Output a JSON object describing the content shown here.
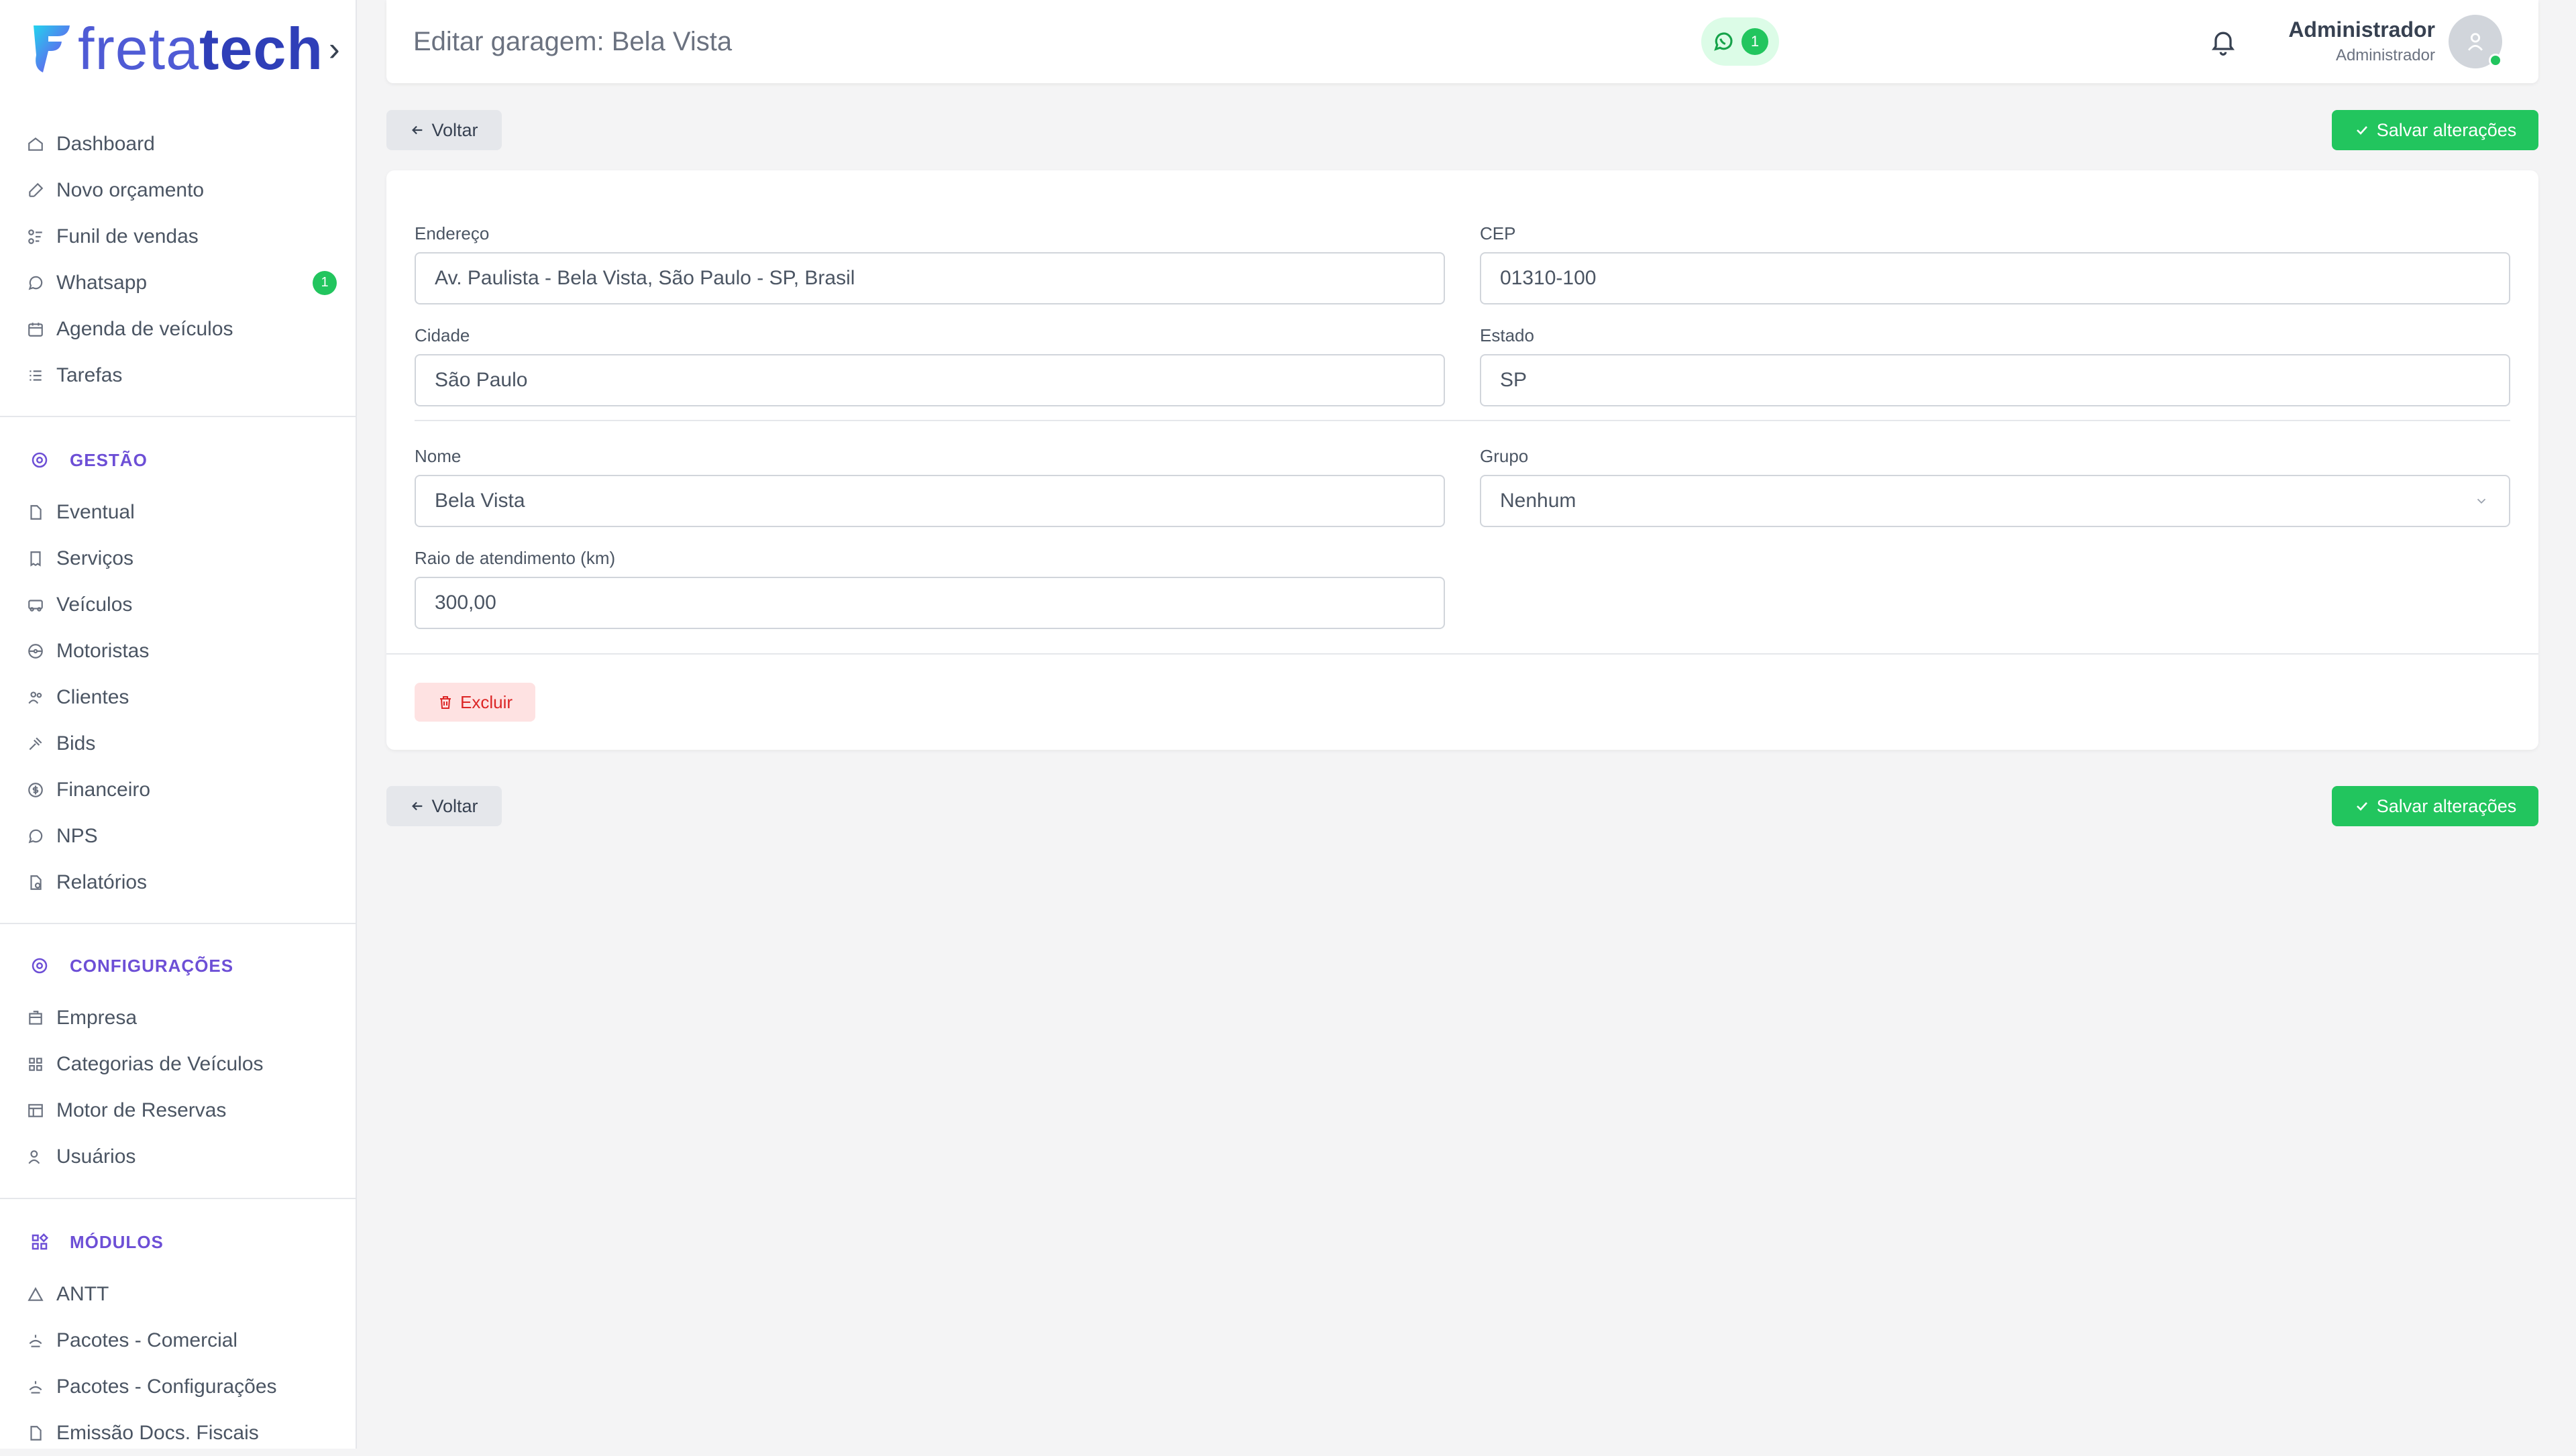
{
  "app": {
    "logo_light": "freta",
    "logo_bold": "tech"
  },
  "sidebar": {
    "main": [
      {
        "label": "Dashboard",
        "icon": "home-icon"
      },
      {
        "label": "Novo orçamento",
        "icon": "edit-icon"
      },
      {
        "label": "Funil de vendas",
        "icon": "funnel-icon"
      },
      {
        "label": "Whatsapp",
        "icon": "whatsapp-icon",
        "badge": "1"
      },
      {
        "label": "Agenda de veículos",
        "icon": "calendar-icon"
      },
      {
        "label": "Tarefas",
        "icon": "list-icon"
      }
    ],
    "sections": [
      {
        "title": "GESTÃO",
        "icon": "gear-icon",
        "items": [
          {
            "label": "Eventual",
            "icon": "document-icon"
          },
          {
            "label": "Serviços",
            "icon": "receipt-icon"
          },
          {
            "label": "Veículos",
            "icon": "bus-icon"
          },
          {
            "label": "Motoristas",
            "icon": "steering-wheel-icon"
          },
          {
            "label": "Clientes",
            "icon": "users-icon"
          },
          {
            "label": "Bids",
            "icon": "gavel-icon"
          },
          {
            "label": "Financeiro",
            "icon": "dollar-icon"
          },
          {
            "label": "NPS",
            "icon": "chat-icon"
          },
          {
            "label": "Relatórios",
            "icon": "report-icon"
          }
        ]
      },
      {
        "title": "CONFIGURAÇÕES",
        "icon": "gear-icon",
        "items": [
          {
            "label": "Empresa",
            "icon": "building-icon"
          },
          {
            "label": "Categorias de Veículos",
            "icon": "grid-icon"
          },
          {
            "label": "Motor de Reservas",
            "icon": "table-icon"
          },
          {
            "label": "Usuários",
            "icon": "user-key-icon"
          }
        ]
      },
      {
        "title": "MÓDULOS",
        "icon": "modules-icon",
        "items": [
          {
            "label": "ANTT",
            "icon": "triangle-icon"
          },
          {
            "label": "Pacotes - Comercial",
            "icon": "package-icon"
          },
          {
            "label": "Pacotes - Configurações",
            "icon": "package-icon"
          },
          {
            "label": "Emissão Docs. Fiscais",
            "icon": "document-icon"
          }
        ]
      }
    ]
  },
  "header": {
    "title": "Editar garagem: Bela Vista",
    "whatsapp_count": "1",
    "user_name": "Administrador",
    "user_role": "Administrador"
  },
  "actions": {
    "back": "Voltar",
    "save": "Salvar alterações",
    "delete": "Excluir"
  },
  "form": {
    "endereco": {
      "label": "Endereço",
      "value": "Av. Paulista - Bela Vista, São Paulo - SP, Brasil"
    },
    "cep": {
      "label": "CEP",
      "value": "01310-100"
    },
    "cidade": {
      "label": "Cidade",
      "value": "São Paulo"
    },
    "estado": {
      "label": "Estado",
      "value": "SP"
    },
    "nome": {
      "label": "Nome",
      "value": "Bela Vista"
    },
    "grupo": {
      "label": "Grupo",
      "value": "Nenhum"
    },
    "raio": {
      "label": "Raio de atendimento (km)",
      "value": "300,00"
    }
  },
  "colors": {
    "accent": "#22c55e",
    "section": "#6d4fd6",
    "danger": "#dc2626"
  }
}
